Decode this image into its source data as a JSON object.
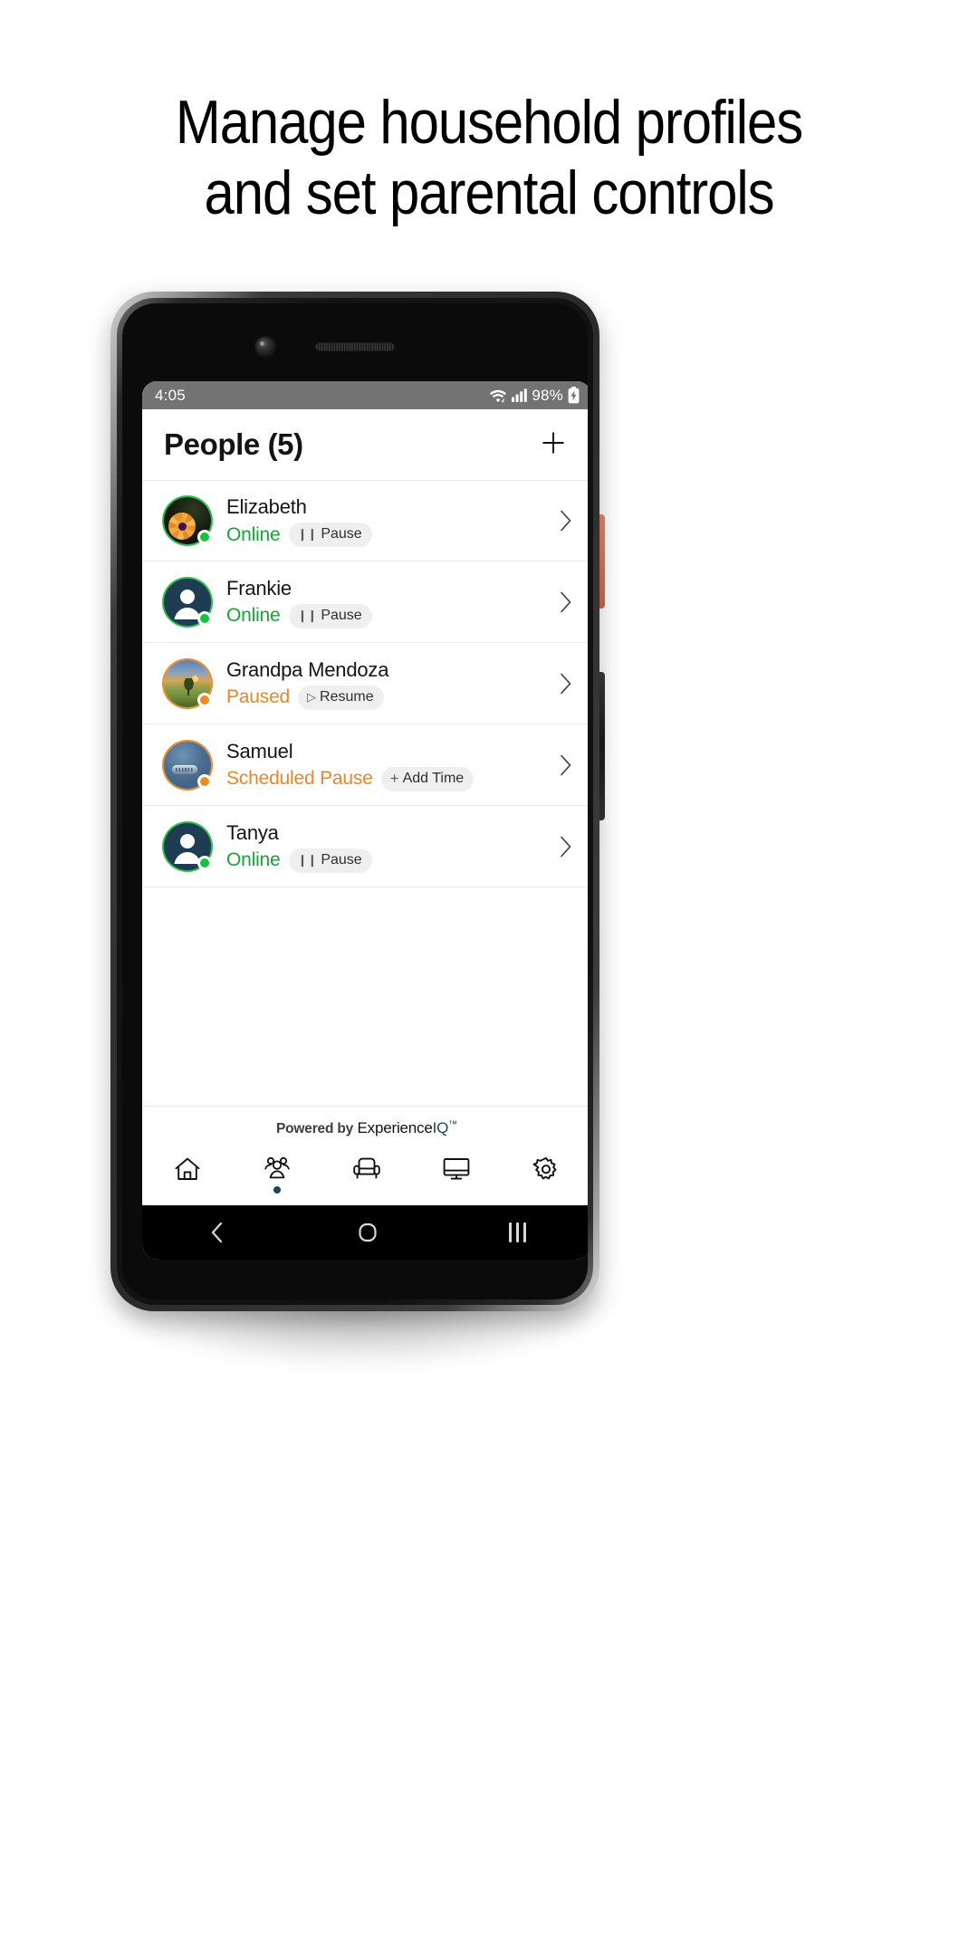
{
  "headline": {
    "line1": "Manage household profiles",
    "line2": "and set parental controls"
  },
  "phone": {
    "status_bar": {
      "time": "4:05",
      "battery_percent": "98%",
      "icons": [
        "wifi-icon",
        "cellular-signal-icon",
        "battery-charging-icon"
      ]
    },
    "app": {
      "header": {
        "title": "People (5)",
        "add_button_label": "+"
      },
      "people": [
        {
          "name": "Elizabeth",
          "status": "Online",
          "status_type": "online",
          "action_label": "Pause",
          "action_icon": "pause-icon",
          "avatar_type": "photo-flower",
          "dot_color": "#14c43c"
        },
        {
          "name": "Frankie",
          "status": "Online",
          "status_type": "online",
          "action_label": "Pause",
          "action_icon": "pause-icon",
          "avatar_type": "person-placeholder",
          "dot_color": "#14c43c"
        },
        {
          "name": "Grandpa Mendoza",
          "status": "Paused",
          "status_type": "paused",
          "action_label": "Resume",
          "action_icon": "play-icon",
          "avatar_type": "photo-landscape",
          "dot_color": "#ef8b26"
        },
        {
          "name": "Samuel",
          "status": "Scheduled Pause",
          "status_type": "paused",
          "action_label": "Add Time",
          "action_icon": "plus-icon",
          "avatar_type": "photo-blue",
          "dot_color": "#ef8b26"
        },
        {
          "name": "Tanya",
          "status": "Online",
          "status_type": "online",
          "action_label": "Pause",
          "action_icon": "pause-icon",
          "avatar_type": "person-placeholder",
          "dot_color": "#14c43c"
        }
      ],
      "footer": {
        "powered_by": "Powered by",
        "brand_name": "Experience",
        "brand_accent": "IQ",
        "brand_tm": "™"
      },
      "tabs": [
        {
          "name": "home",
          "icon": "home-icon",
          "active": false
        },
        {
          "name": "people",
          "icon": "people-icon",
          "active": true
        },
        {
          "name": "places",
          "icon": "armchair-icon",
          "active": false
        },
        {
          "name": "devices",
          "icon": "monitor-icon",
          "active": false
        },
        {
          "name": "settings",
          "icon": "gear-icon",
          "active": false
        }
      ]
    },
    "android_nav": {
      "back": "back-icon",
      "home": "home-square-icon",
      "recents": "recents-icon"
    }
  },
  "colors": {
    "online": "#16a538",
    "paused": "#e8862a",
    "brand": "#20435f",
    "statusbar": "#737373"
  }
}
